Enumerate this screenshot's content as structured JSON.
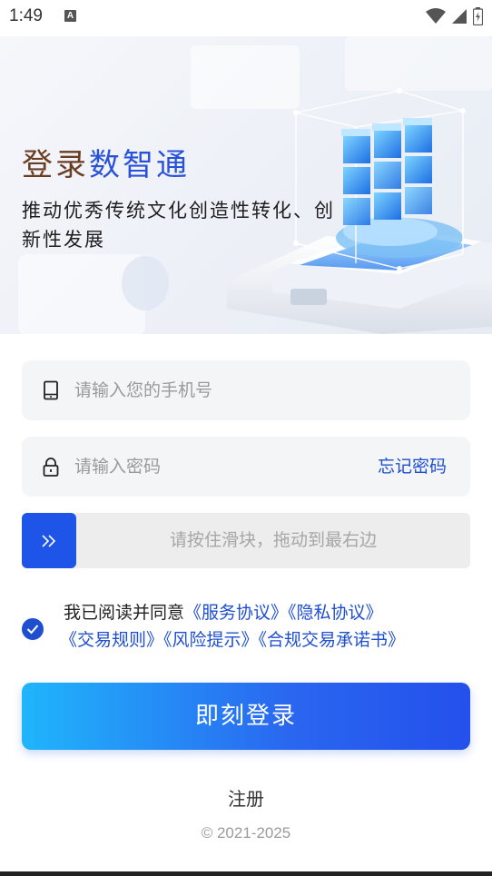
{
  "status_bar": {
    "time": "1:49",
    "notification_icon": "A"
  },
  "banner": {
    "title_part1": "登录",
    "title_part2": "数智通",
    "subtitle": "推动优秀传统文化创造性转化、创新性发展",
    "colors": {
      "title_brown": "#6b3d22",
      "title_blue": "#2a52d8"
    }
  },
  "form": {
    "phone": {
      "placeholder": "请输入您的手机号",
      "icon": "phone-icon"
    },
    "password": {
      "placeholder": "请输入密码",
      "icon": "lock-icon",
      "forgot_label": "忘记密码"
    },
    "slider": {
      "hint": "请按住滑块，拖动到最右边",
      "icon": "double-chevron-right-icon"
    },
    "agreement": {
      "checked": true,
      "prefix": "我已阅读并同意",
      "links": [
        "《服务协议》",
        "《隐私协议》",
        "《交易规则》",
        "《风险提示》",
        "《合规交易承诺书》"
      ]
    },
    "login_label": "即刻登录",
    "register_label": "注册"
  },
  "footer": {
    "copyright": "© 2021-2025"
  },
  "colors": {
    "accent": "#1f4fd1",
    "slider_handle": "#1f54e8",
    "button_start": "#20b5fb",
    "button_end": "#2450ec"
  }
}
